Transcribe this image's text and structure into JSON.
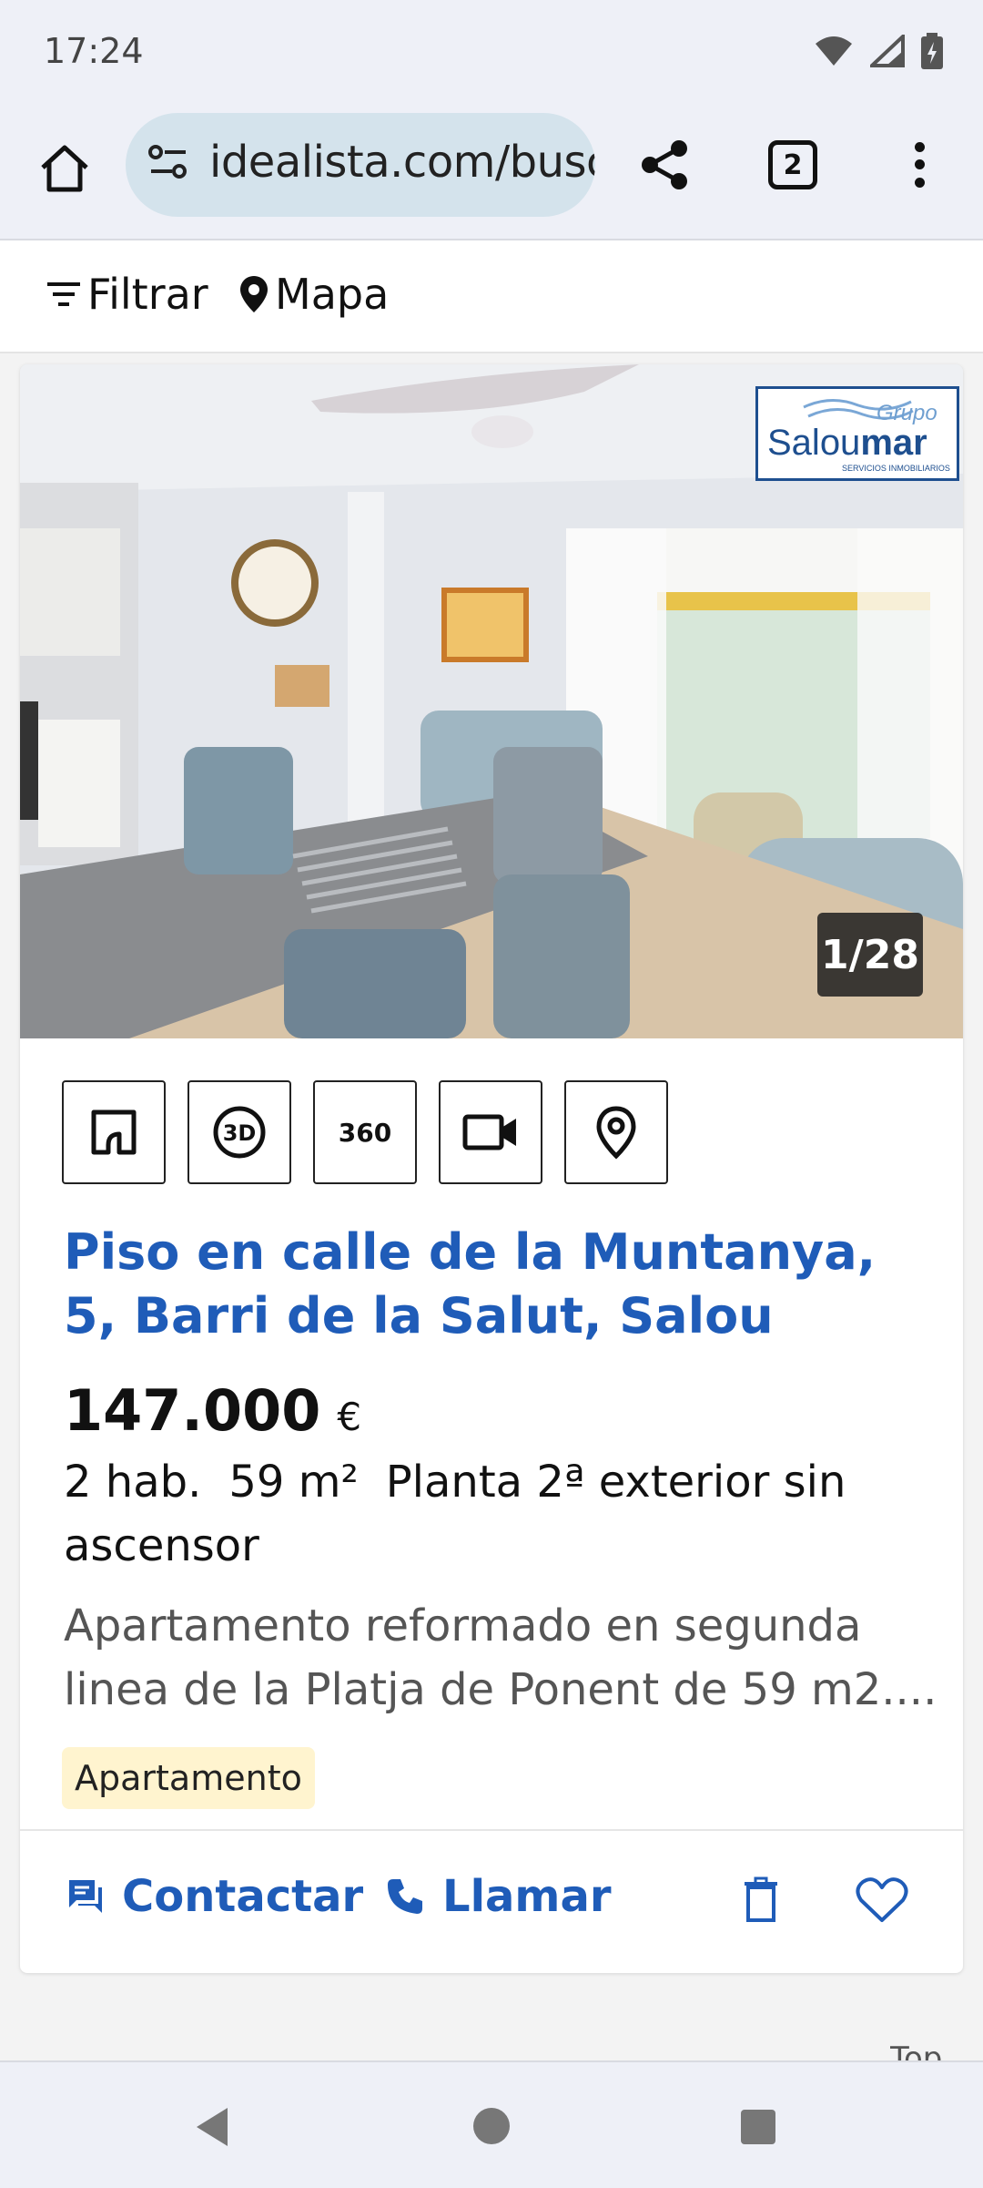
{
  "status_bar": {
    "time": "17:24"
  },
  "browser": {
    "url": "idealista.com/busc",
    "tab_count": "2"
  },
  "filter_bar": {
    "filter_label": "Filtrar",
    "map_label": "Mapa"
  },
  "listing": {
    "photo_counter": "1/28",
    "agency": {
      "line1": "Grupo",
      "line2": "Salou",
      "line3": "mar",
      "line4": "SERVICIOS INMOBILIARIOS"
    },
    "media_icons": [
      "floor-plan-icon",
      "3d-tour-icon",
      "360-view-icon",
      "video-icon",
      "location-pin-icon"
    ],
    "media_360_label": "360",
    "media_3d_label": "3D",
    "title": "Piso en calle de la Muntanya, 5, Barri de la Salut, Salou",
    "price": "147.000",
    "currency": "€",
    "details": {
      "rooms": "2 hab.",
      "size": "59 m²",
      "floor": "Planta 2ª exterior sin ascensor"
    },
    "description": "Apartamento reformado en segunda\nlinea de la Platja de Ponent de 59 m2....",
    "tag": "Apartamento",
    "actions": {
      "contact_label": "Contactar",
      "call_label": "Llamar"
    }
  },
  "footer": {
    "top_label": "Top"
  },
  "colors": {
    "link_blue": "#1f5cb8",
    "tag_bg": "#fff4cf",
    "chrome_bg": "#eef0f7"
  }
}
